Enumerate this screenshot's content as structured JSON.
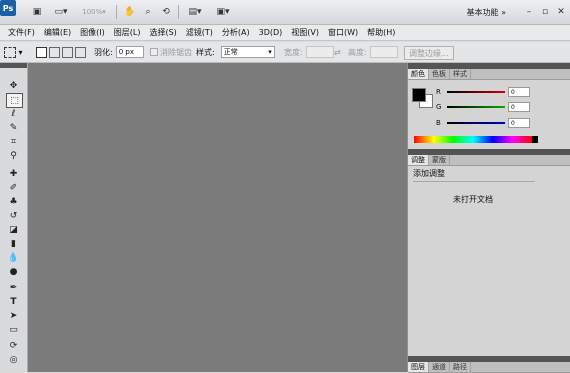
{
  "titlebar": {
    "logo": "Ps",
    "zoom": "100%",
    "workspace": "基本功能",
    "icons": [
      "bridge-icon",
      "view-extras-icon",
      "zoom-level-icon",
      "hand-icon",
      "zoom-icon",
      "rotate-view-icon",
      "arrange-documents-icon",
      "screen-mode-icon"
    ]
  },
  "menu": [
    "文件(F)",
    "编辑(E)",
    "图像(I)",
    "图层(L)",
    "选择(S)",
    "滤镜(T)",
    "分析(A)",
    "3D(D)",
    "视图(V)",
    "窗口(W)",
    "帮助(H)"
  ],
  "options": {
    "feather_label": "羽化:",
    "feather_value": "0 px",
    "antialias": "消除锯齿",
    "style_label": "样式:",
    "style_value": "正常",
    "width_label": "宽度:",
    "height_label": "高度:",
    "refine_edge": "调整边缘..."
  },
  "panels": {
    "color": {
      "tabs": [
        "颜色",
        "色板",
        "样式"
      ],
      "active": 0,
      "channels": [
        {
          "label": "R",
          "value": "0"
        },
        {
          "label": "G",
          "value": "0"
        },
        {
          "label": "B",
          "value": "0"
        }
      ]
    },
    "adjust": {
      "tabs": [
        "调整",
        "蒙版"
      ],
      "active": 0,
      "title": "添加调整",
      "empty_text": "未打开文档"
    },
    "layers": {
      "tabs": [
        "图层",
        "通道",
        "路径"
      ],
      "active": 0
    }
  },
  "colors": {
    "canvas": "#7b7b7b",
    "panel_header": "#545454",
    "foreground": "#000000",
    "background": "#ffffff"
  }
}
